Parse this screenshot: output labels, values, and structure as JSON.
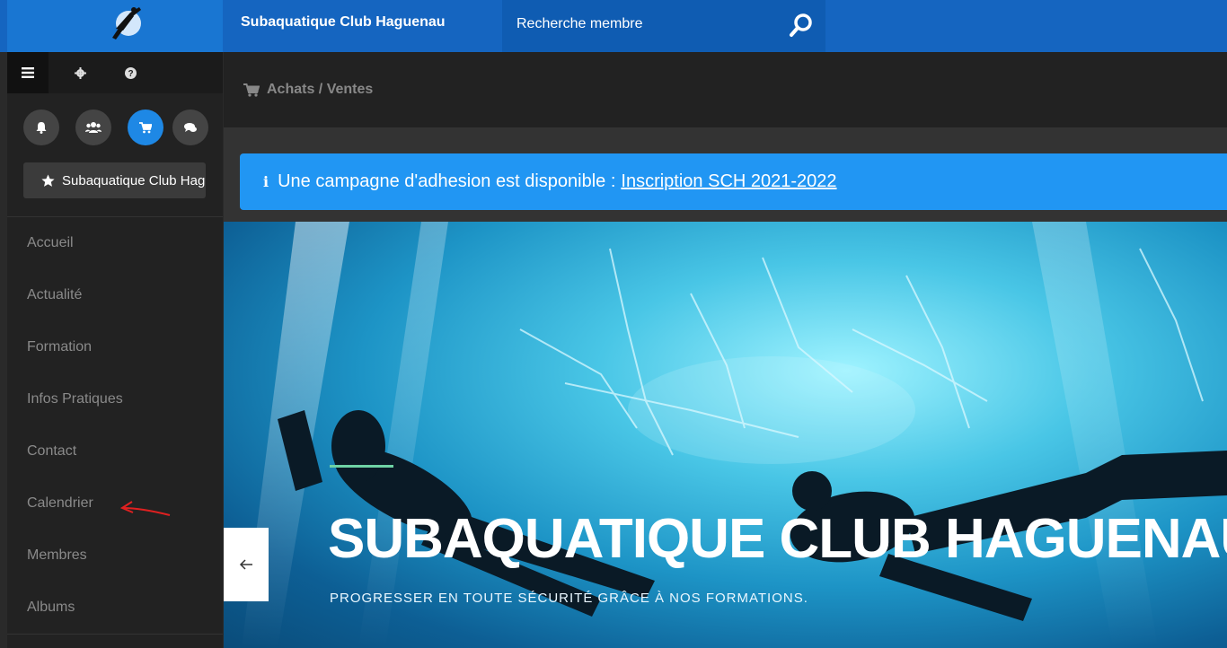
{
  "header": {
    "club_name": "Subaquatique Club Haguenau",
    "search_placeholder": "Recherche membre"
  },
  "sidebar": {
    "club_button": "Subaquatique Club Hag",
    "items": [
      {
        "label": "Accueil"
      },
      {
        "label": "Actualité"
      },
      {
        "label": "Formation"
      },
      {
        "label": "Infos Pratiques"
      },
      {
        "label": "Contact"
      },
      {
        "label": "Calendrier"
      },
      {
        "label": "Membres"
      },
      {
        "label": "Albums"
      }
    ]
  },
  "breadcrumb": {
    "label": "Achats / Ventes"
  },
  "alert": {
    "text": "Une campagne d'adhesion est disponible :",
    "link": "Inscription SCH 2021-2022",
    "icon": "i"
  },
  "hero": {
    "title": "SUBAQUATIQUE CLUB HAGUENAU",
    "subtitle": "PROGRESSER EN TOUTE SÉCURITÉ GRÂCE À NOS FORMATIONS."
  },
  "colors": {
    "topbar": "#1565c0",
    "alert": "#2196f3",
    "active_circle": "#1e88e5"
  }
}
